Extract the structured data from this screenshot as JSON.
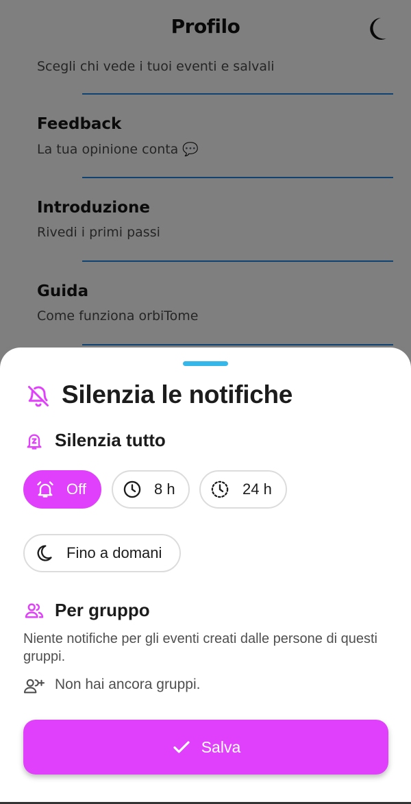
{
  "topbar": {
    "title": "Profilo",
    "theme_icon": "moon-icon"
  },
  "profile_menu": {
    "items": [
      {
        "title": "",
        "subtitle": "Scegli chi vede i tuoi eventi e salvali"
      },
      {
        "title": "Feedback",
        "subtitle": "La tua opinione conta 💬"
      },
      {
        "title": "Introduzione",
        "subtitle": "Rivedi i primi passi"
      },
      {
        "title": "Guida",
        "subtitle": "Come funziona orbiTome"
      }
    ]
  },
  "sheet": {
    "title": "Silenzia le notifiche",
    "title_icon": "bell-off-icon",
    "mute_all": {
      "title": "Silenzia tutto",
      "icon": "bell-snooze-icon",
      "options": [
        {
          "label": "Off",
          "icon": "alarm-off-icon",
          "selected": true
        },
        {
          "label": "8 h",
          "icon": "clock-icon",
          "selected": false
        },
        {
          "label": "24 h",
          "icon": "clock-dashed-icon",
          "selected": false
        },
        {
          "label": "Fino a domani",
          "icon": "moon-icon",
          "selected": false
        }
      ]
    },
    "by_group": {
      "title": "Per gruppo",
      "icon": "group-icon",
      "description": "Niente notifiche per gli eventi creati dalle persone di questi gruppi.",
      "empty_text": "Non hai ancora gruppi.",
      "empty_icon": "add-group-icon"
    },
    "save_label": "Salva",
    "save_icon": "check-icon"
  },
  "colors": {
    "accent": "#e040fb",
    "handle": "#36b7ea",
    "divider": "#1e88e5"
  }
}
